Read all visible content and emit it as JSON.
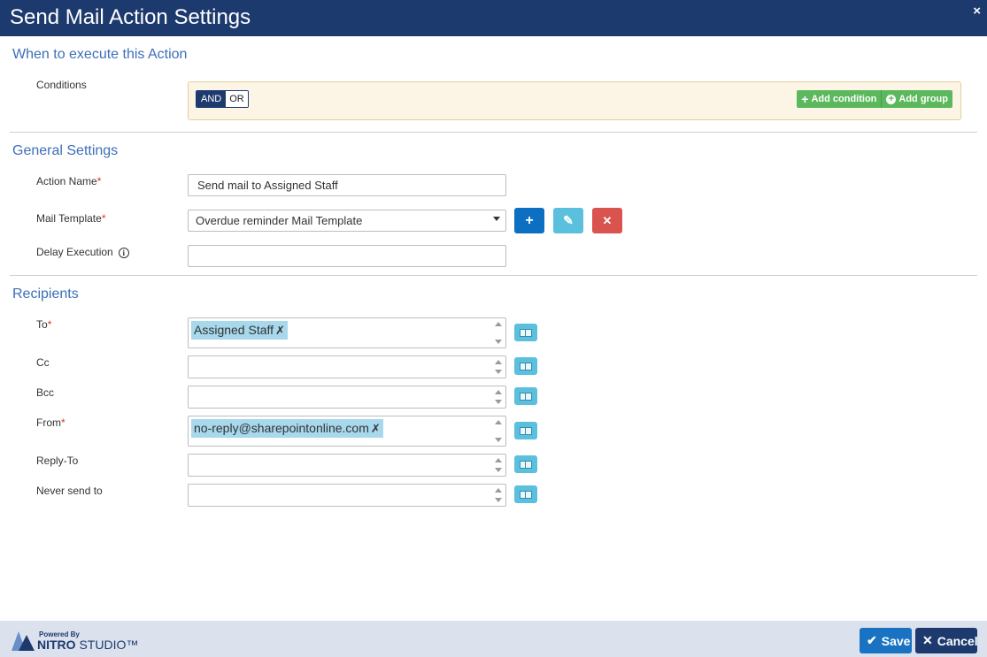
{
  "dialog": {
    "title": "Send Mail Action Settings",
    "close_glyph": "×"
  },
  "sections": {
    "when": "When to execute this Action",
    "general": "General Settings",
    "recipients": "Recipients"
  },
  "conditions": {
    "label": "Conditions",
    "and_label": "AND",
    "or_label": "OR",
    "add_condition": "Add condition",
    "add_group": "Add group"
  },
  "general": {
    "action_name_label": "Action Name",
    "action_name_value": "Send mail to Assigned Staff",
    "mail_template_label": "Mail Template",
    "mail_template_value": "Overdue reminder Mail Template",
    "delay_label": "Delay Execution",
    "delay_value": "",
    "required_mark": "*",
    "info_glyph": "i",
    "add_glyph": "+",
    "edit_glyph": "✎",
    "delete_glyph": "✕"
  },
  "recipients": {
    "to_label": "To",
    "to_tags": [
      "Assigned Staff"
    ],
    "cc_label": "Cc",
    "bcc_label": "Bcc",
    "from_label": "From",
    "from_tags": [
      "no-reply@sharepointonline.com"
    ],
    "reply_to_label": "Reply-To",
    "never_send_label": "Never send to",
    "tag_remove_glyph": "✗"
  },
  "footer": {
    "powered_by": "Powered By",
    "brand_nitro": "NITRO",
    "brand_studio": " STUDIO™",
    "save_label": "Save",
    "cancel_label": "Cancel",
    "save_glyph": "✔",
    "cancel_glyph": "✕"
  },
  "colors": {
    "header": "#1d3a6e",
    "section_title": "#3c6fb6",
    "add_green": "#5cb85c",
    "primary_blue": "#0c6fc2",
    "info_cyan": "#5bc0de",
    "danger_red": "#d9534f",
    "save_btn": "#1a73c2",
    "cancel_btn": "#1d3a6e"
  }
}
